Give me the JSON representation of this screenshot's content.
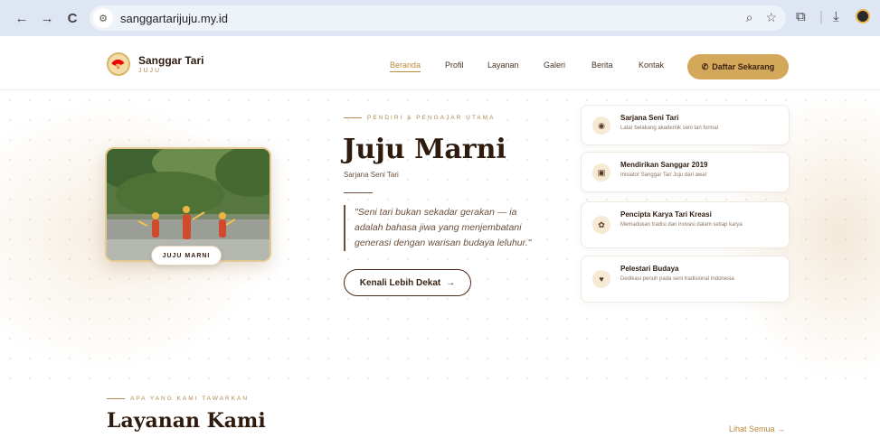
{
  "browser": {
    "url": "sanggartarijuju.my.id",
    "back_icon": "←",
    "forward_icon": "→",
    "reload_icon": "C",
    "zoom_icon": "⌕",
    "star_icon": "☆",
    "extensions_icon": "⧉",
    "download_icon": "⤓"
  },
  "nav": {
    "brand_title": "Sanggar Tari",
    "brand_sub": "JUJU",
    "items": [
      "Beranda",
      "Profil",
      "Layanan",
      "Galeri",
      "Berita",
      "Kontak"
    ],
    "cta_label": "Daftar Sekarang"
  },
  "hero": {
    "photo_badge": "JUJU MARNI",
    "eyebrow": "PENDIRI & PENGAJAR UTAMA",
    "name": "Juju Marni",
    "subtitle": "Sarjana Seni Tari",
    "quote": "\"Seni tari bukan sekadar gerakan — ia adalah bahasa jiwa yang menjembatani generasi dengan warisan budaya leluhur.\"",
    "button_label": "Kenali Lebih Dekat",
    "button_arrow": "→"
  },
  "features": [
    {
      "icon": "graduation-icon",
      "glyph": "◉",
      "title": "Sarjana Seni Tari",
      "desc": "Latar belakang akademik seni tari formal"
    },
    {
      "icon": "calendar-icon",
      "glyph": "▣",
      "title": "Mendirikan Sanggar 2019",
      "desc": "Inisiator Sanggar Tari Juju dari awal"
    },
    {
      "icon": "palette-icon",
      "glyph": "✿",
      "title": "Pencipta Karya Tari Kreasi",
      "desc": "Memadukan tradisi dan inovasi dalam setiap karya"
    },
    {
      "icon": "heart-icon",
      "glyph": "♥",
      "title": "Pelestari Budaya",
      "desc": "Dedikasi penuh pada seni tradisional Indonesia"
    }
  ],
  "services": {
    "eyebrow": "APA YANG KAMI TAWARKAN",
    "title": "Layanan Kami",
    "see_all": "Lihat Semua →"
  }
}
